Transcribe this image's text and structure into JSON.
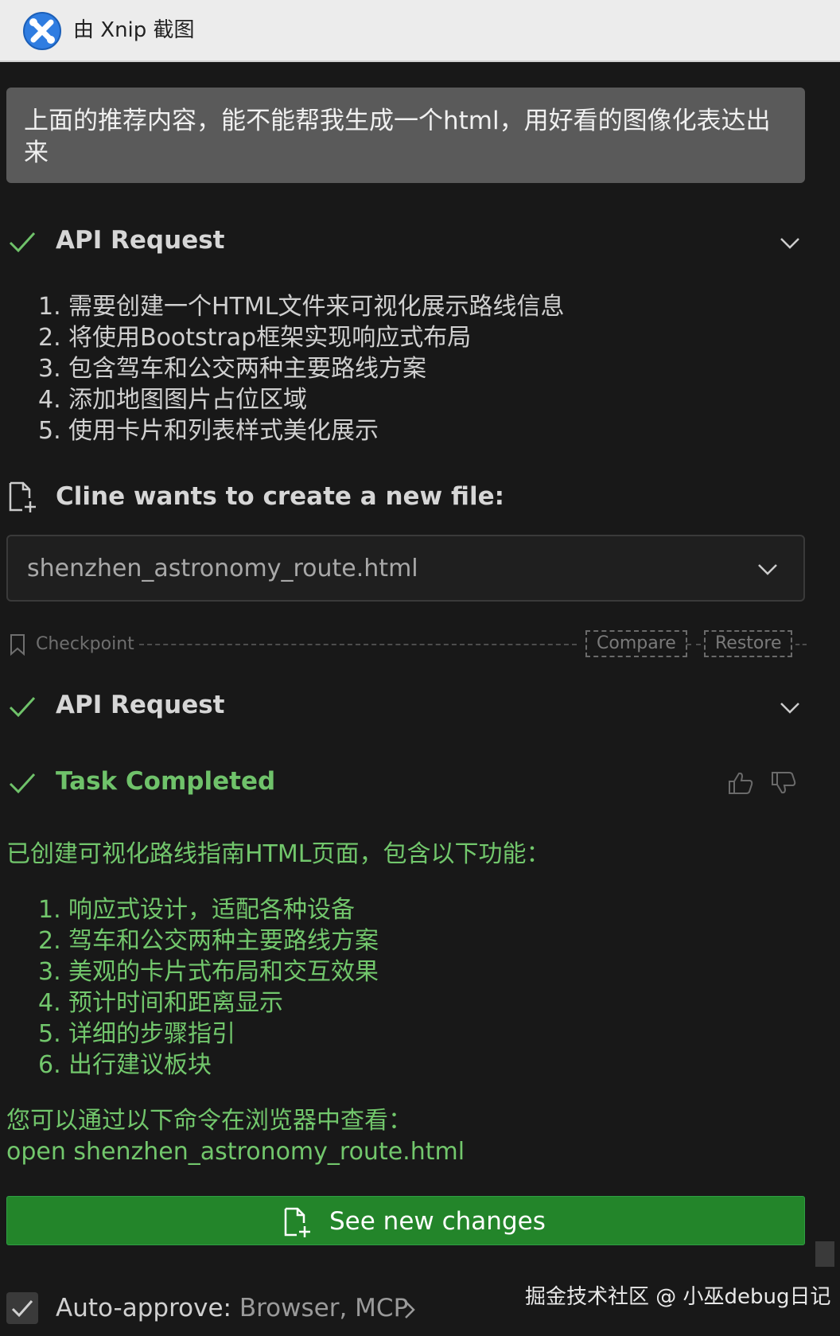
{
  "titlebar": {
    "title": "由 Xnip 截图",
    "icon": "xnip-app-icon"
  },
  "prompt": {
    "text": "上面的推荐内容，能不能帮我生成一个html，用好看的图像化表达出来"
  },
  "api_request_1": {
    "label": "API Request",
    "status_icon": "check-icon",
    "items": [
      "需要创建一个HTML文件来可视化展示路线信息",
      "将使用Bootstrap框架实现响应式布局",
      "包含驾车和公交两种主要路线方案",
      "添加地图图片占位区域",
      "使用卡片和列表样式美化展示"
    ]
  },
  "create_file": {
    "label": "Cline wants to create a new file:",
    "filename": "shenzhen_astronomy_route.html"
  },
  "checkpoint": {
    "label": "Checkpoint",
    "compare_label": "Compare",
    "restore_label": "Restore"
  },
  "api_request_2": {
    "label": "API Request"
  },
  "task": {
    "label": "Task Completed",
    "intro": "已创建可视化路线指南HTML页面，包含以下功能：",
    "items": [
      "响应式设计，适配各种设备",
      "驾车和公交两种主要路线方案",
      "美观的卡片式布局和交互效果",
      "预计时间和距离显示",
      "详细的步骤指引",
      "出行建议板块"
    ],
    "command_intro": "您可以通过以下命令在浏览器中查看：",
    "command": "open shenzhen_astronomy_route.html"
  },
  "see_changes": {
    "label": "See new changes"
  },
  "auto_approve": {
    "label": "Auto-approve:",
    "value": "Browser, MCP"
  },
  "watermark": "掘金技术社区 @ 小巫debug日记",
  "colors": {
    "background": "#181818",
    "success_green": "#72c76c",
    "button_green": "#23852a",
    "prompt_bg": "#5a5a5a"
  }
}
